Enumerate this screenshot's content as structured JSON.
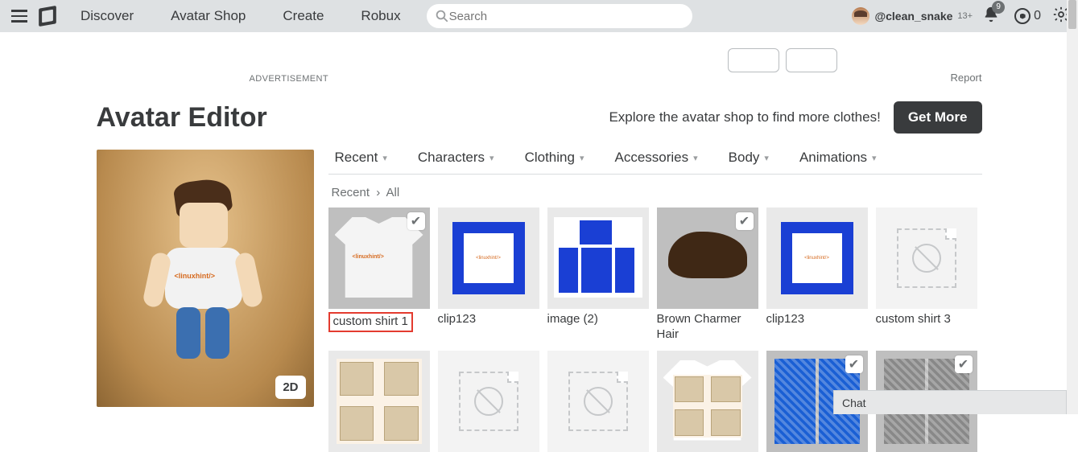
{
  "nav": {
    "links": [
      "Discover",
      "Avatar Shop",
      "Create",
      "Robux"
    ],
    "search_placeholder": "Search",
    "username": "@clean_snake",
    "age": "13+",
    "notif_count": "9",
    "robux_count": "0"
  },
  "ad": {
    "label": "ADVERTISEMENT",
    "report": "Report"
  },
  "header": {
    "title": "Avatar Editor",
    "explore": "Explore the avatar shop to find more clothes!",
    "get_more": "Get More"
  },
  "tabs": [
    "Recent",
    "Characters",
    "Clothing",
    "Accessories",
    "Body",
    "Animations"
  ],
  "breadcrumb": {
    "a": "Recent",
    "b": "All"
  },
  "items_row1": [
    {
      "label": "custom shirt 1"
    },
    {
      "label": "clip123"
    },
    {
      "label": "image (2)"
    },
    {
      "label": "Brown Charmer Hair"
    },
    {
      "label": "clip123"
    },
    {
      "label": "custom shirt 3"
    }
  ],
  "preview": {
    "toggle": "2D"
  },
  "chat": {
    "label": "Chat"
  }
}
